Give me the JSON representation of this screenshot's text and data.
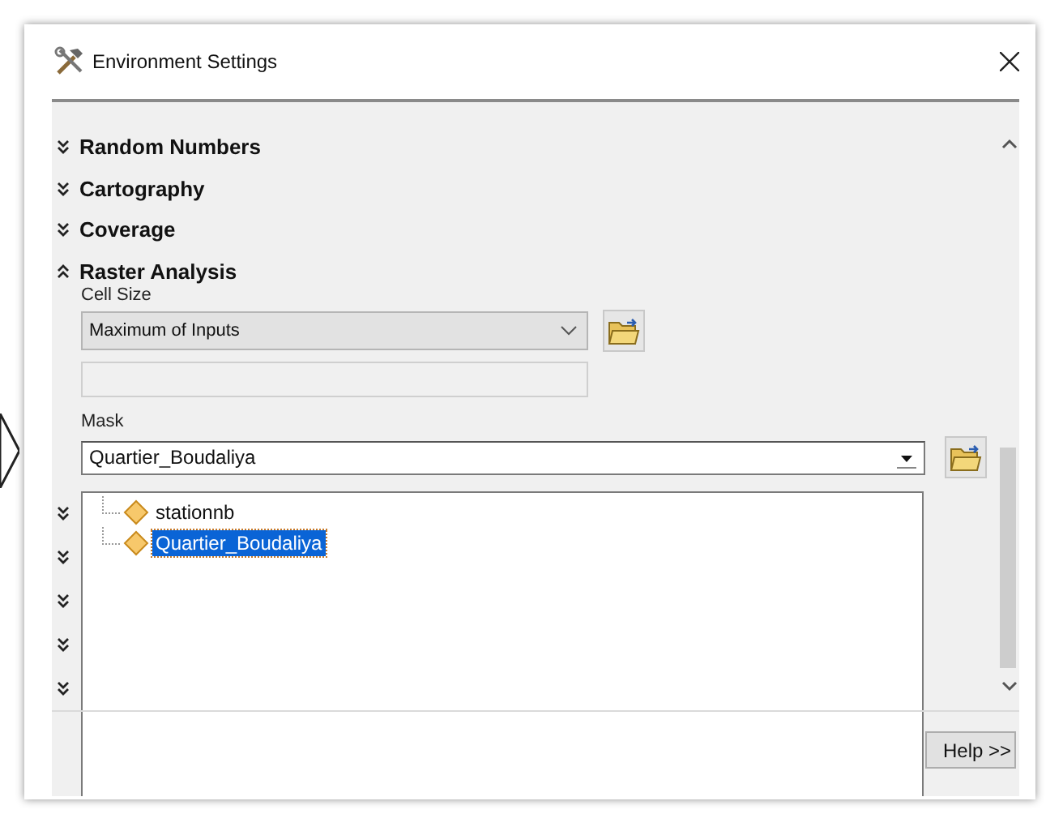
{
  "window": {
    "title": "Environment Settings"
  },
  "sections": [
    {
      "label": "Random Numbers",
      "expanded": false
    },
    {
      "label": "Cartography",
      "expanded": false
    },
    {
      "label": "Coverage",
      "expanded": false
    },
    {
      "label": "Raster Analysis",
      "expanded": true
    }
  ],
  "cell_size": {
    "label": "Cell Size",
    "value": "Maximum of Inputs"
  },
  "mask": {
    "label": "Mask",
    "value": "Quartier_Boudaliya",
    "options": [
      {
        "label": "stationnb",
        "selected": false
      },
      {
        "label": "Quartier_Boudaliya",
        "selected": true
      }
    ]
  },
  "buttons": [
    {
      "label": "Help >>"
    }
  ]
}
